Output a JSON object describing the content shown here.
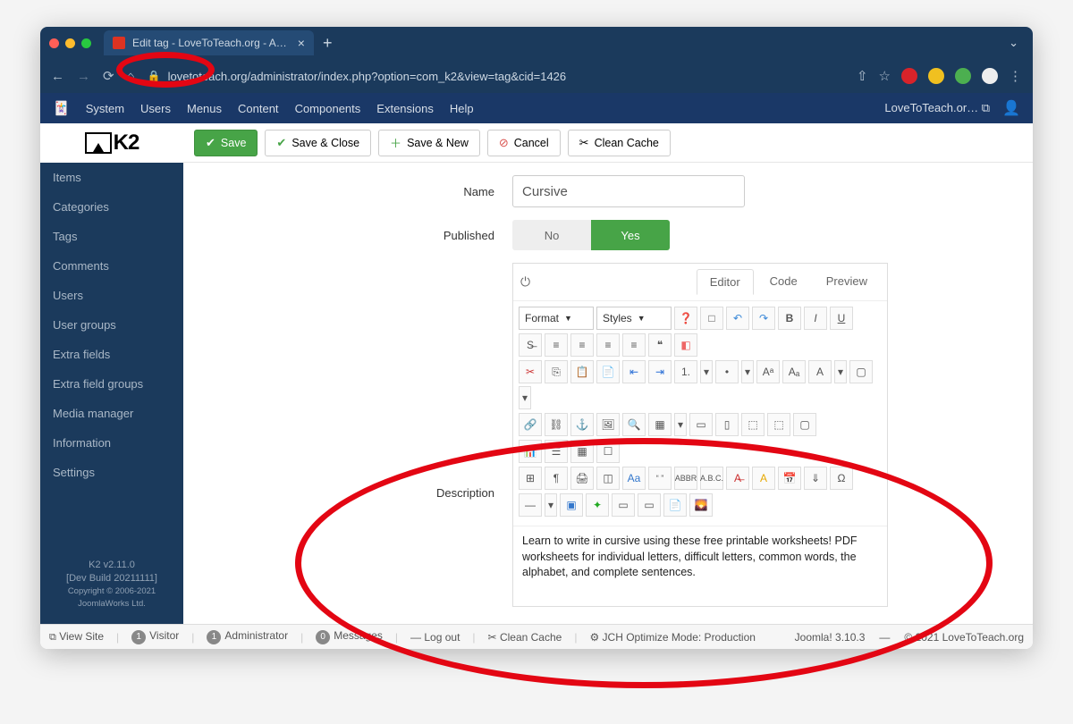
{
  "browser": {
    "tab_title": "Edit tag - LoveToTeach.org - A…",
    "url": "lovetoteach.org/administrator/index.php?option=com_k2&view=tag&cid=1426"
  },
  "adminbar": {
    "items": [
      "System",
      "Users",
      "Menus",
      "Content",
      "Components",
      "Extensions",
      "Help"
    ],
    "sitename": "LoveToTeach.or…"
  },
  "brand": "K2",
  "sidebar": {
    "items": [
      "Items",
      "Categories",
      "Tags",
      "Comments",
      "Users",
      "User groups",
      "Extra fields",
      "Extra field groups",
      "Media manager",
      "Information",
      "Settings"
    ],
    "footer_version": "K2 v2.11.0",
    "footer_build": "[Dev Build 20211111]",
    "footer_copyright": "Copyright © 2006-2021 JoomlaWorks Ltd."
  },
  "toolbar": {
    "save": "Save",
    "save_close": "Save & Close",
    "save_new": "Save & New",
    "cancel": "Cancel",
    "clean_cache": "Clean Cache"
  },
  "form": {
    "name_label": "Name",
    "name_value": "Cursive",
    "published_label": "Published",
    "published_no": "No",
    "published_yes": "Yes",
    "description_label": "Description",
    "editor_tabs": {
      "editor": "Editor",
      "code": "Code",
      "preview": "Preview"
    },
    "format_select": "Format",
    "styles_select": "Styles",
    "description_text": "Learn to write in cursive using these free printable worksheets!  PDF worksheets for individual letters, difficult letters, common words, the alphabet, and complete sentences."
  },
  "statusbar": {
    "view_site": "View Site",
    "visitors": "1",
    "visitor_label": "Visitor",
    "admins": "1",
    "admin_label": "Administrator",
    "msgs": "0",
    "msg_label": "Messages",
    "logout": "Log out",
    "clean_cache": "Clean Cache",
    "jch": "JCH Optimize Mode: Production",
    "joomla_ver": "Joomla! 3.10.3",
    "copyright": "© 2021 LoveToTeach.org"
  }
}
